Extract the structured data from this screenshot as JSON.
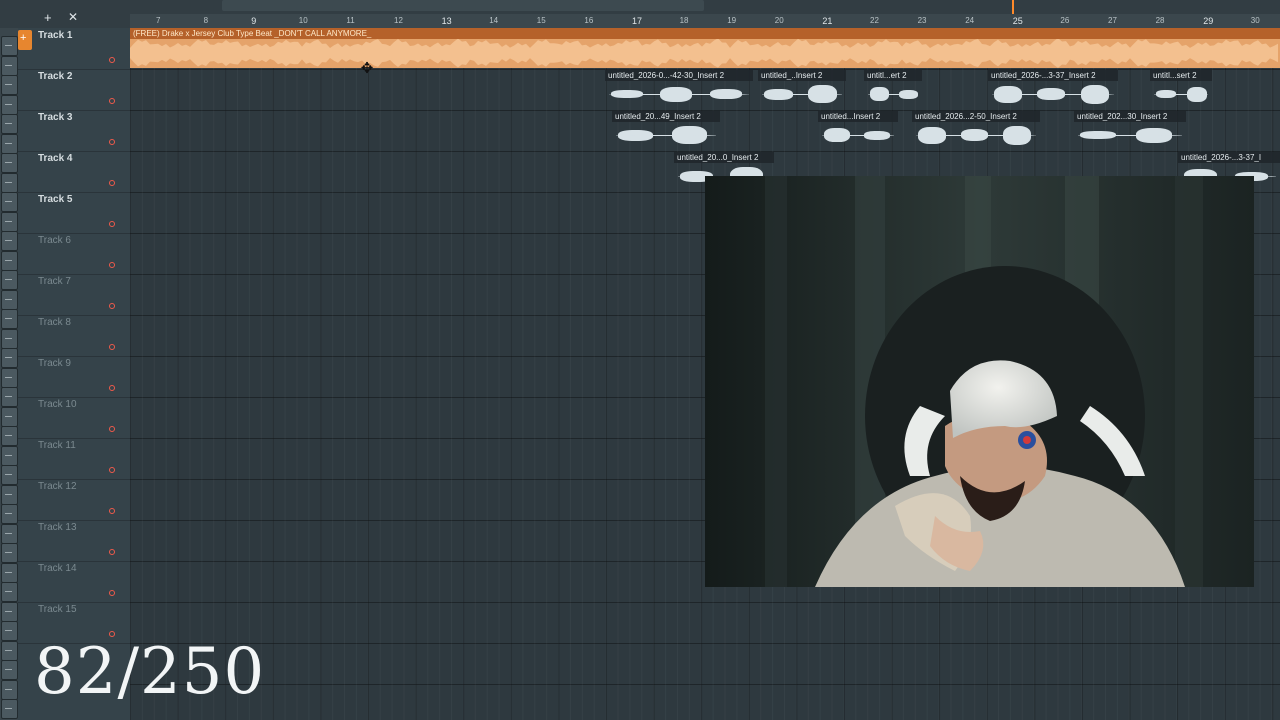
{
  "toolbar": {
    "add_icon": "plus-icon",
    "add_label": "+",
    "close_icon": "close-icon",
    "close_label": "✕"
  },
  "ruler": {
    "bars": [
      "7",
      "8",
      "9",
      "10",
      "11",
      "12",
      "13",
      "14",
      "15",
      "16",
      "17",
      "18",
      "19",
      "20",
      "21",
      "22",
      "23",
      "24",
      "25",
      "26",
      "27",
      "28",
      "29",
      "30"
    ]
  },
  "tracks": [
    {
      "label": "Track 1"
    },
    {
      "label": "Track 2"
    },
    {
      "label": "Track 3"
    },
    {
      "label": "Track 4"
    },
    {
      "label": "Track 5"
    },
    {
      "label": "Track 6"
    },
    {
      "label": "Track 7"
    },
    {
      "label": "Track 8"
    },
    {
      "label": "Track 9"
    },
    {
      "label": "Track 10"
    },
    {
      "label": "Track 11"
    },
    {
      "label": "Track 12"
    },
    {
      "label": "Track 13"
    },
    {
      "label": "Track 14"
    },
    {
      "label": "Track 15"
    }
  ],
  "main_clip": {
    "title": "(FREE) Drake x Jersey Club Type Beat _DON'T CALL ANYMORE_",
    "color": "#d79b5f"
  },
  "clips": [
    {
      "track": 2,
      "title": "untitled_2026-0...-42-30_Insert 2"
    },
    {
      "track": 2,
      "title": "untitled_..Insert 2"
    },
    {
      "track": 2,
      "title": "untitl...ert 2"
    },
    {
      "track": 2,
      "title": "untitled_2026-...3-37_Insert 2"
    },
    {
      "track": 2,
      "title": "untitl...sert 2"
    },
    {
      "track": 3,
      "title": "untitled_20...49_Insert 2"
    },
    {
      "track": 3,
      "title": "untitled...Insert 2"
    },
    {
      "track": 3,
      "title": "untitled_2026...2-50_Insert 2"
    },
    {
      "track": 3,
      "title": "untitled_202...30_Insert 2"
    },
    {
      "track": 4,
      "title": "untitled_20...0_Insert 2"
    },
    {
      "track": 4,
      "title": "untitled_2026-...3-37_I"
    }
  ],
  "counter": "82/250",
  "colors": {
    "accent": "#e7862f",
    "playlist_bg": "#2e393f",
    "record_dot": "#f05a4a"
  }
}
